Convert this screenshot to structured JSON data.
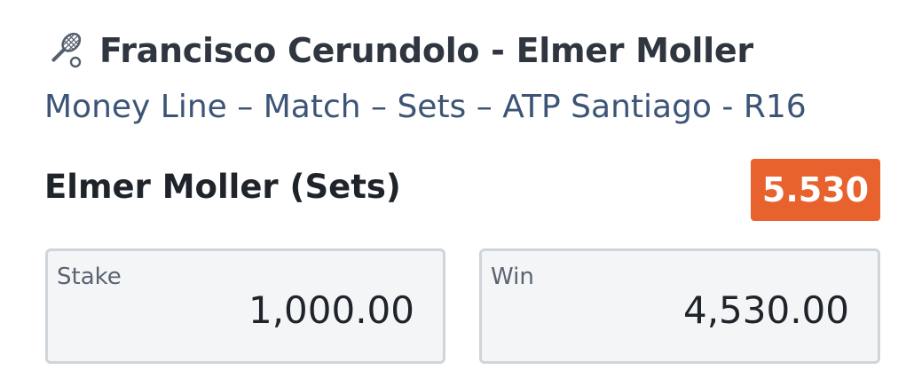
{
  "match": {
    "icon": "tennis-racket-icon",
    "title": "Francisco Cerundolo - Elmer Moller"
  },
  "market": {
    "description": "Money Line – Match – Sets – ATP Santiago - R16"
  },
  "selection": {
    "name": "Elmer Moller (Sets)",
    "odds": "5.530",
    "odds_color": "#e8622e"
  },
  "stake": {
    "label": "Stake",
    "value": "1,000.00"
  },
  "win": {
    "label": "Win",
    "value": "4,530.00"
  }
}
